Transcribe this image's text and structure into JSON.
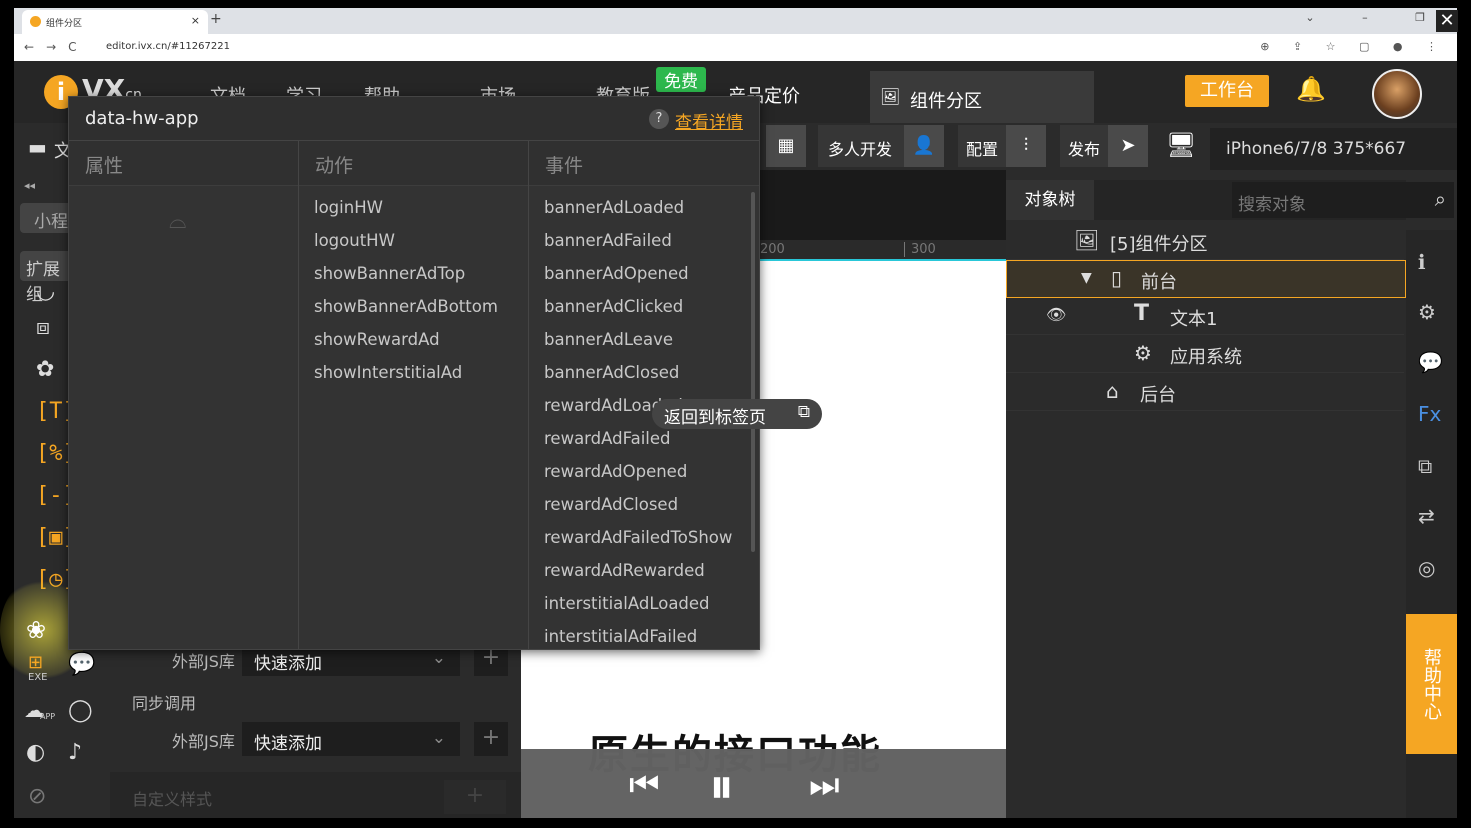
{
  "browser": {
    "tab_title": "组件分区",
    "tab_close": "×",
    "new_tab": "+",
    "url": "editor.ivx.cn/#11267221",
    "nav_back": "←",
    "nav_forward": "→",
    "nav_reload": "C"
  },
  "topbar": {
    "logo_letter": "i",
    "logo_text": "VX",
    "logo_suffix": "cn",
    "menu": [
      "文档",
      "学习",
      "帮助",
      "市场",
      "教育版",
      "产品定价"
    ],
    "free_badge": "免费",
    "active_tab": "组件分区",
    "workbench_button": "工作台"
  },
  "toolbar": {
    "multi_dev": "多人开发",
    "config": "配置",
    "publish": "发布",
    "device": "iPhone6/7/8 375*667"
  },
  "leftbar": {
    "top_item": "文",
    "collapse": "◂◂",
    "mini_label": "小程",
    "extend_label": "扩展组",
    "exe_label": "EXE",
    "app_label": "APP"
  },
  "lowerleft": {
    "ext_js_label_1": "外部JS库",
    "quick_add_1": "快速添加",
    "sync_call": "同步调用",
    "ext_js_label_2": "外部JS库",
    "quick_add_2": "快速添加",
    "custom_style": "自定义样式"
  },
  "popover": {
    "component_name": "data-hw-app",
    "detail_link": "查看详情",
    "col_props": "属性",
    "col_actions": "动作",
    "col_events": "事件",
    "actions": [
      "loginHW",
      "logoutHW",
      "showBannerAdTop",
      "showBannerAdBottom",
      "showRewardAd",
      "showInterstitialAd"
    ],
    "events": [
      "bannerAdLoaded",
      "bannerAdFailed",
      "bannerAdOpened",
      "bannerAdClicked",
      "bannerAdLeave",
      "bannerAdClosed",
      "rewardAdLoaded",
      "rewardAdFailed",
      "rewardAdOpened",
      "rewardAdClosed",
      "rewardAdFailedToShow",
      "rewardAdRewarded",
      "interstitialAdLoaded",
      "interstitialAdFailed"
    ]
  },
  "toast": {
    "text": "返回到标签页"
  },
  "canvas": {
    "ruler_200": "200",
    "ruler_300": "300",
    "caption": "原生的接口功能"
  },
  "objectTree": {
    "tab_label": "对象树",
    "search_placeholder": "搜索对象",
    "root": "[5]组件分区",
    "front": "前台",
    "text1": "文本1",
    "app_system": "应用系统",
    "back": "后台"
  },
  "rightstrip": {
    "help_center": "帮助中心"
  },
  "colors": {
    "accent": "#f5a623",
    "free_green": "#2db84d",
    "panel_bg": "#2b2b2b"
  }
}
